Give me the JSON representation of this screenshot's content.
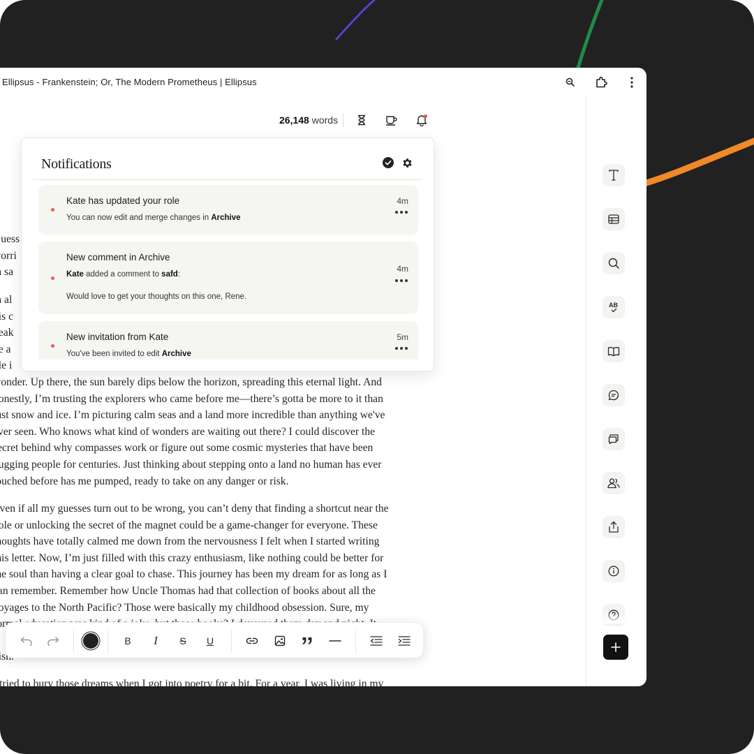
{
  "window": {
    "title": "Ellipsus - Frankenstein; Or, The Modern Prometheus | Ellipsus"
  },
  "titlebar_icons": [
    "zoom-icon",
    "extension-icon",
    "more-vert-icon"
  ],
  "doc_header": {
    "word_count": "26,148",
    "word_label": " words",
    "icons": [
      "hourglass-icon",
      "coffee-icon",
      "bell-icon"
    ],
    "bell_badge_color": "#e0624f"
  },
  "notifications": {
    "title": "Notifications",
    "header_icons": [
      "check-all-icon",
      "settings-icon"
    ],
    "items": [
      {
        "title": "Kate has updated your role",
        "line1_pre": "You can now edit and merge changes in ",
        "line1_bold": "Archive",
        "time": "4m",
        "unread": true
      },
      {
        "title": "New comment in Archive",
        "line1_bold_lead": "Kate",
        "line1_mid": " added a comment to ",
        "line1_bold": "safd",
        "line1_post": ":",
        "quote": "Would love to get your thoughts on this one, Rene.",
        "time": "4m",
        "unread": true
      },
      {
        "title": "New invitation from Kate",
        "line1_pre": "You've been invited to edit ",
        "line1_bold": "Archive",
        "time": "5m",
        "unread": true
      }
    ]
  },
  "document": {
    "paragraphs": [
      "Guess\nworri\nm sa",
      "m al\nhis c\nneak\nke a\nole i\nwonder. Up there, the sun barely dips below the horizon, spreading this eternal light. And\nhonestly, I’m trusting the explorers who came before me—there’s gotta be more to it than\njust snow and ice. I’m picturing calm seas and a land more incredible than anything we've\never seen. Who knows what kind of wonders are waiting out there? I could discover the\nsecret behind why compasses work or figure out some cosmic mysteries that have been\nbugging people for centuries. Just thinking about stepping onto a land no human has ever\ntouched before has me pumped, ready to take on any danger or risk.",
      "Even if all my guesses turn out to be wrong, you can’t deny that finding a shortcut near the\npole or unlocking the secret of the magnet could be a game-changer for everyone. These\nthoughts have totally calmed me down from the nervousness I felt when I started writing\nthis letter. Now, I’m just filled with this crazy enthusiasm, like nothing could be better for\nthe soul than having a clear goal to chase. This journey has been my dream for as long as I\ncan remember. Remember how Uncle Thomas had that collection of books about all the\nvoyages to the North Pacific? Those were basically my childhood obsession. Sure, my\nformal education was kind of a joke, but those books? I devoured them day and night. It\nn\nvish.",
      "I tried to bury those dreams when I got into poetry for a bit. For a year, I was living in my"
    ]
  },
  "right_rail": {
    "buttons": [
      "text-icon",
      "table-icon",
      "search-icon",
      "spellcheck-icon",
      "book-icon",
      "comment-icon",
      "comments-icon",
      "users-icon",
      "share-icon",
      "info-icon",
      "help-icon"
    ],
    "fab": "plus-icon"
  },
  "toolbar": {
    "tools": [
      "undo-icon",
      "redo-icon",
      "text-color-swatch",
      "bold-icon",
      "italic-icon",
      "strikethrough-icon",
      "underline-icon",
      "link-icon",
      "image-icon",
      "quote-icon",
      "divider-icon",
      "outdent-icon",
      "indent-icon"
    ],
    "bold_glyph": "B",
    "italic_glyph": "I",
    "strike_glyph": "S",
    "underline_glyph": "U",
    "text_color": "#222222"
  },
  "colors": {
    "backdrop": "#212121",
    "accent_unread": "#e0624f",
    "stroke_purple": "#5b3fd6",
    "stroke_green": "#1f8a4c",
    "stroke_orange": "#f0892a"
  }
}
